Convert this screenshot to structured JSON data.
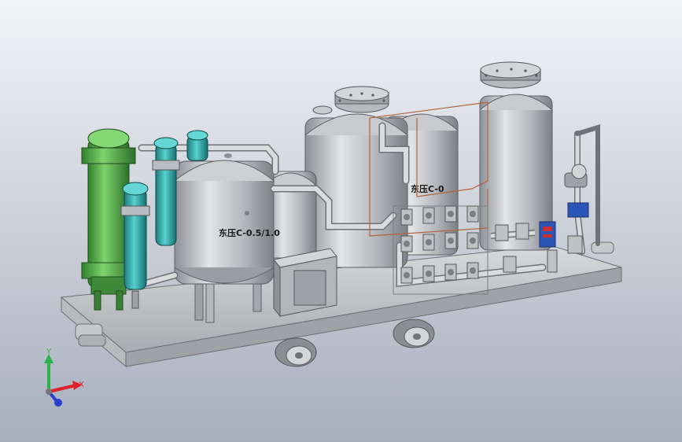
{
  "viewport": {
    "background_top": "#f2f4f7",
    "background_bottom": "#a7aebd"
  },
  "labels": {
    "tank_left": "东压C-0.5/1.0",
    "tank_right": "东压C-0"
  },
  "triad": {
    "x_label": "X",
    "y_label": "Y",
    "x_color": "#e0202a",
    "y_color": "#2eb34a",
    "z_color": "#2a3fd0"
  },
  "colors": {
    "green_vessel": "#5cb84e",
    "teal_filter": "#2fa8a8",
    "steel": "#b9bcc0",
    "frame": "#c9cbce",
    "valve_blue": "#2c55b8",
    "valve_red": "#c83030",
    "pipe_outline": "#b2623a"
  }
}
